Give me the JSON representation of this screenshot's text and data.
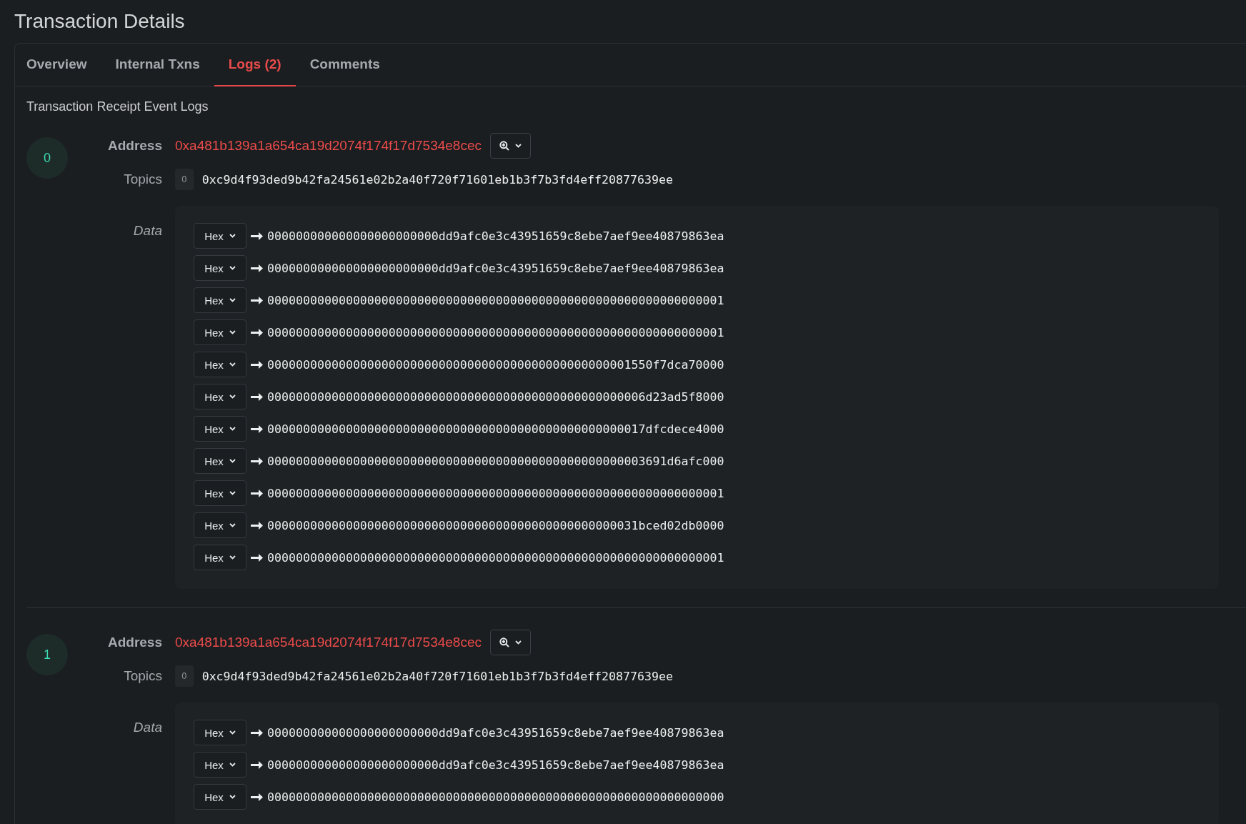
{
  "title": "Transaction Details",
  "tabs": [
    {
      "label": "Overview",
      "selected": false
    },
    {
      "label": "Internal Txns",
      "selected": false
    },
    {
      "label": "Logs (2)",
      "selected": true
    },
    {
      "label": "Comments",
      "selected": false
    }
  ],
  "section_title": "Transaction Receipt Event Logs",
  "logs": [
    {
      "index": "0",
      "address_label": "Address",
      "address": "0xa481b139a1a654ca19d2074f174f17d7534e8cec",
      "topics_label": "Topics",
      "topics": [
        {
          "index": "0",
          "value": "0xc9d4f93ded9b42fa24561e02b2a40f720f71601eb1b3f7b3fd4eff20877639ee"
        }
      ],
      "data_label": "Data",
      "data": [
        {
          "format": "Hex",
          "value": "000000000000000000000000dd9afc0e3c43951659c8ebe7aef9ee40879863ea"
        },
        {
          "format": "Hex",
          "value": "000000000000000000000000dd9afc0e3c43951659c8ebe7aef9ee40879863ea"
        },
        {
          "format": "Hex",
          "value": "0000000000000000000000000000000000000000000000000000000000000001"
        },
        {
          "format": "Hex",
          "value": "0000000000000000000000000000000000000000000000000000000000000001"
        },
        {
          "format": "Hex",
          "value": "000000000000000000000000000000000000000000000000001550f7dca70000"
        },
        {
          "format": "Hex",
          "value": "00000000000000000000000000000000000000000000000000006d23ad5f8000"
        },
        {
          "format": "Hex",
          "value": "00000000000000000000000000000000000000000000000000017dfcdece4000"
        },
        {
          "format": "Hex",
          "value": "00000000000000000000000000000000000000000000000000003691d6afc000"
        },
        {
          "format": "Hex",
          "value": "0000000000000000000000000000000000000000000000000000000000000001"
        },
        {
          "format": "Hex",
          "value": "0000000000000000000000000000000000000000000000000031bced02db0000"
        },
        {
          "format": "Hex",
          "value": "0000000000000000000000000000000000000000000000000000000000000001"
        }
      ]
    },
    {
      "index": "1",
      "address_label": "Address",
      "address": "0xa481b139a1a654ca19d2074f174f17d7534e8cec",
      "topics_label": "Topics",
      "topics": [
        {
          "index": "0",
          "value": "0xc9d4f93ded9b42fa24561e02b2a40f720f71601eb1b3f7b3fd4eff20877639ee"
        }
      ],
      "data_label": "Data",
      "data": [
        {
          "format": "Hex",
          "value": "000000000000000000000000dd9afc0e3c43951659c8ebe7aef9ee40879863ea"
        },
        {
          "format": "Hex",
          "value": "000000000000000000000000dd9afc0e3c43951659c8ebe7aef9ee40879863ea"
        },
        {
          "format": "Hex",
          "value": "0000000000000000000000000000000000000000000000000000000000000000"
        }
      ]
    }
  ]
}
